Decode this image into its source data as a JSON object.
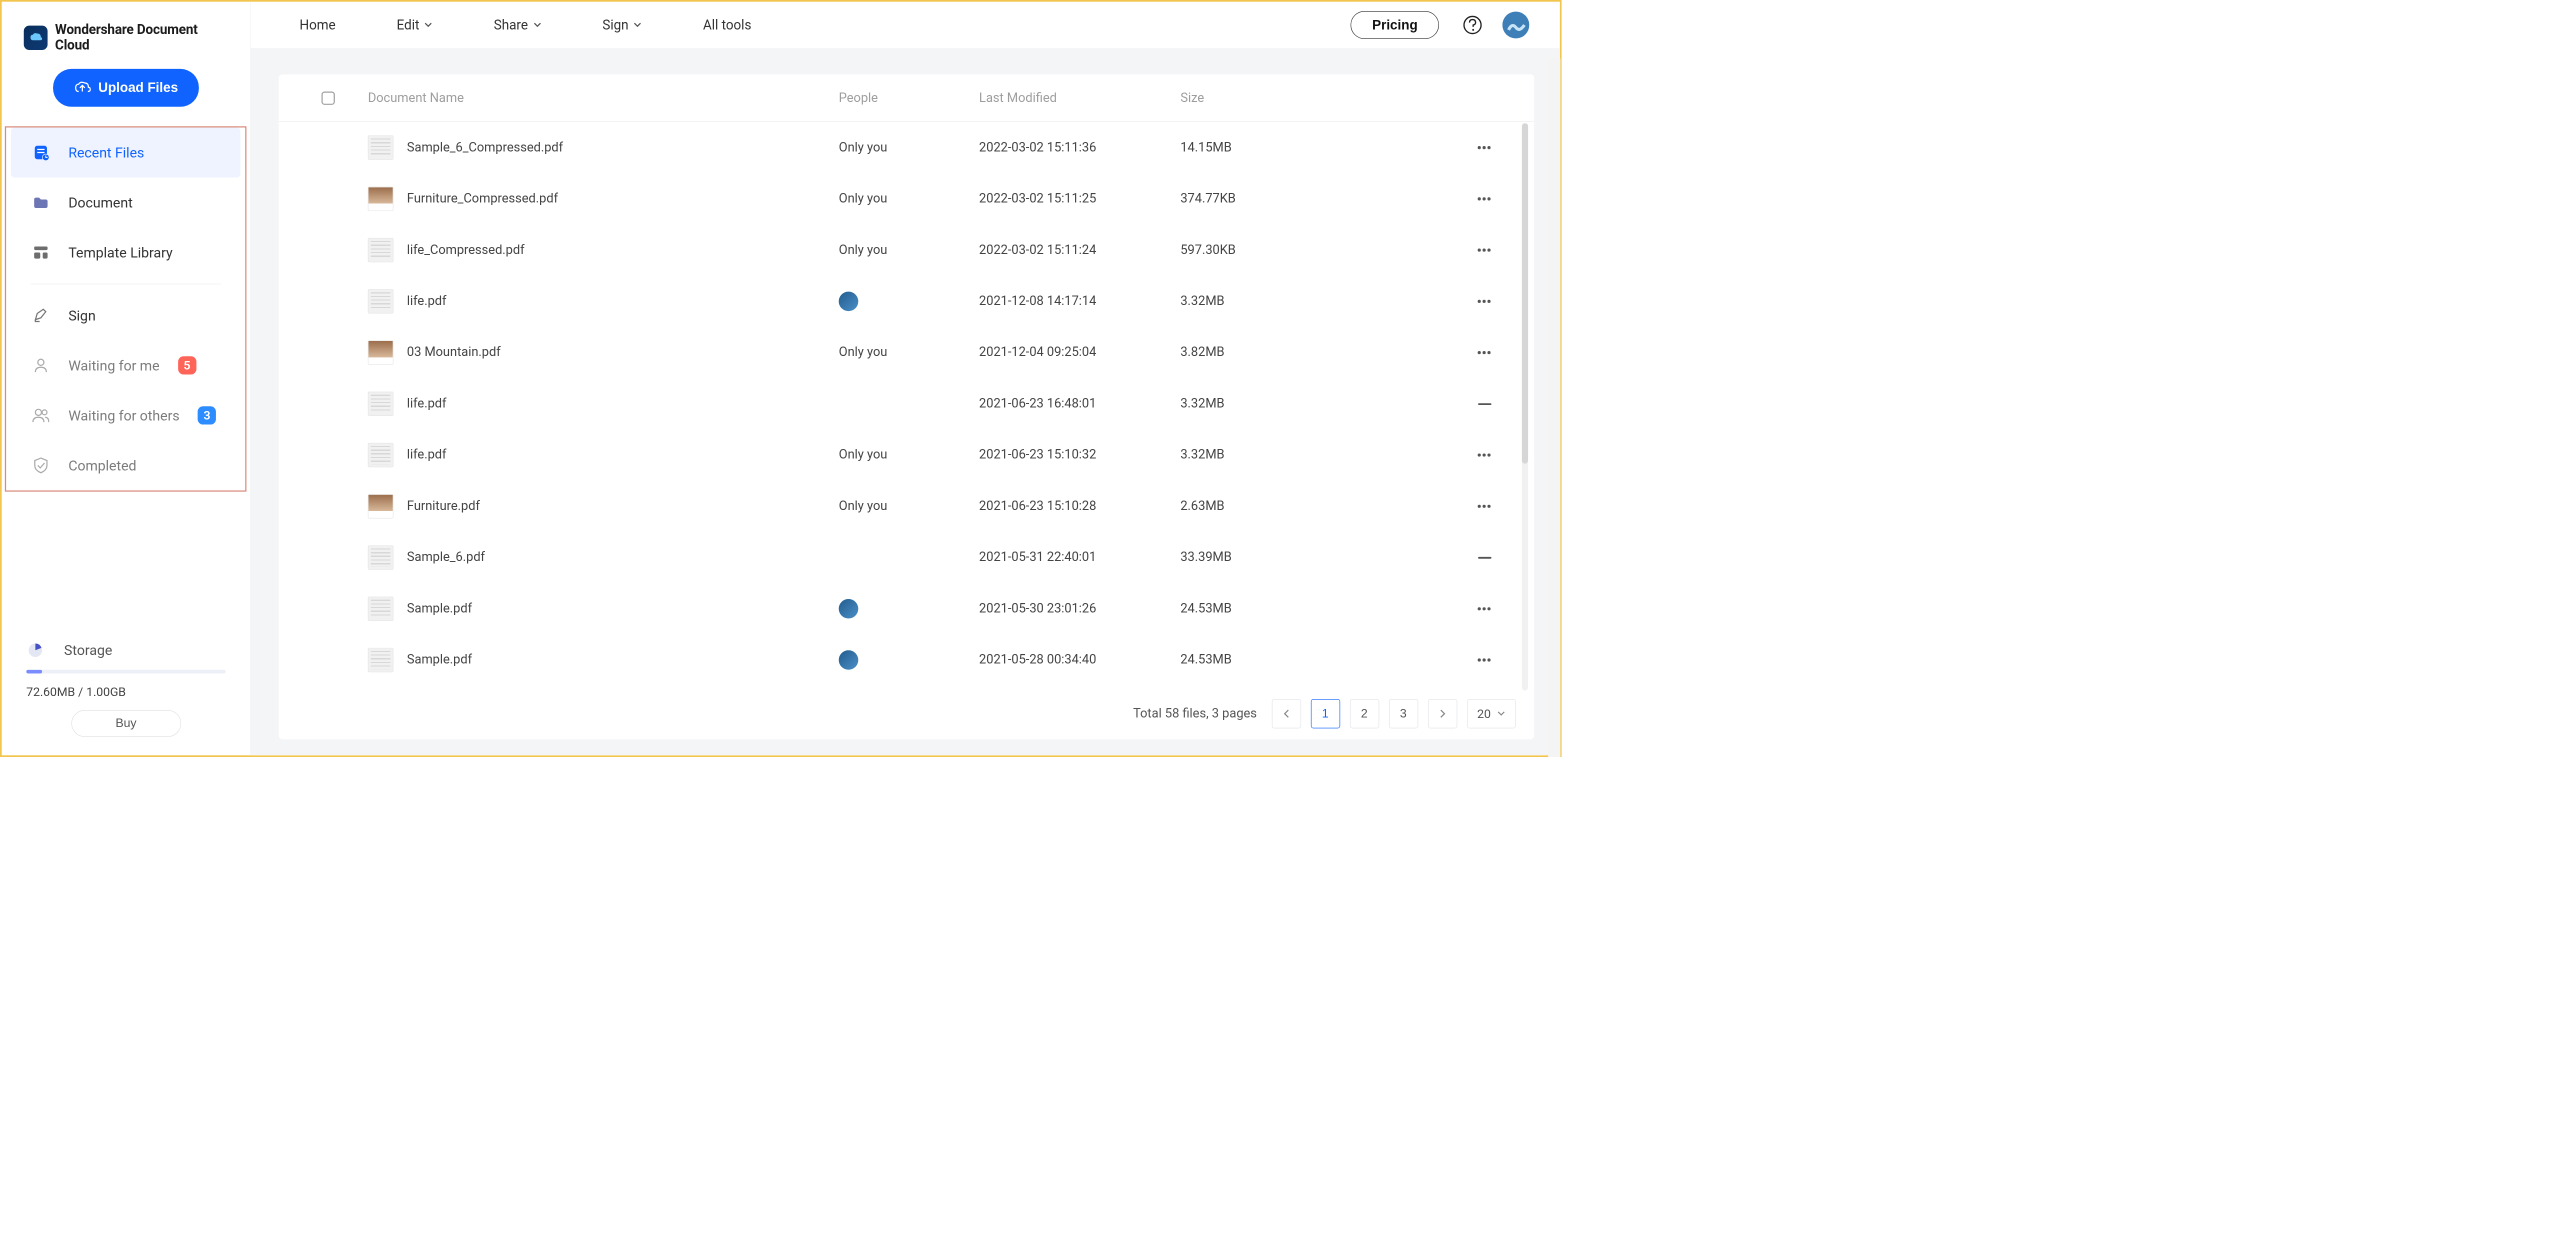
{
  "brand": "Wondershare Document Cloud",
  "upload_label": "Upload Files",
  "nav": {
    "recent": "Recent Files",
    "document": "Document",
    "template_library": "Template Library",
    "sign": "Sign",
    "waiting_for_me": "Waiting for me",
    "waiting_for_me_count": "5",
    "waiting_for_others": "Waiting for others",
    "waiting_for_others_count": "3",
    "completed": "Completed"
  },
  "storage": {
    "label": "Storage",
    "usage": "72.60MB / 1.00GB",
    "buy_label": "Buy"
  },
  "topnav": {
    "home": "Home",
    "edit": "Edit",
    "share": "Share",
    "sign": "Sign",
    "all_tools": "All tools",
    "pricing": "Pricing"
  },
  "table": {
    "columns": {
      "name": "Document Name",
      "people": "People",
      "modified": "Last Modified",
      "size": "Size"
    },
    "rows": [
      {
        "name": "Sample_6_Compressed.pdf",
        "people_type": "text",
        "people": "Only you",
        "modified": "2022-03-02 15:11:36",
        "size": "14.15MB",
        "action": "dots",
        "thumb": "doc"
      },
      {
        "name": "Furniture_Compressed.pdf",
        "people_type": "text",
        "people": "Only you",
        "modified": "2022-03-02 15:11:25",
        "size": "374.77KB",
        "action": "dots",
        "thumb": "img"
      },
      {
        "name": "life_Compressed.pdf",
        "people_type": "text",
        "people": "Only you",
        "modified": "2022-03-02 15:11:24",
        "size": "597.30KB",
        "action": "dots",
        "thumb": "doc"
      },
      {
        "name": "life.pdf",
        "people_type": "avatar",
        "people": "",
        "modified": "2021-12-08 14:17:14",
        "size": "3.32MB",
        "action": "dots",
        "thumb": "doc"
      },
      {
        "name": "03 Mountain.pdf",
        "people_type": "text",
        "people": "Only you",
        "modified": "2021-12-04 09:25:04",
        "size": "3.82MB",
        "action": "dots",
        "thumb": "img"
      },
      {
        "name": "life.pdf",
        "people_type": "none",
        "people": "",
        "modified": "2021-06-23 16:48:01",
        "size": "3.32MB",
        "action": "minus",
        "thumb": "doc"
      },
      {
        "name": "life.pdf",
        "people_type": "text",
        "people": "Only you",
        "modified": "2021-06-23 15:10:32",
        "size": "3.32MB",
        "action": "dots",
        "thumb": "doc"
      },
      {
        "name": "Furniture.pdf",
        "people_type": "text",
        "people": "Only you",
        "modified": "2021-06-23 15:10:28",
        "size": "2.63MB",
        "action": "dots",
        "thumb": "img"
      },
      {
        "name": "Sample_6.pdf",
        "people_type": "none",
        "people": "",
        "modified": "2021-05-31 22:40:01",
        "size": "33.39MB",
        "action": "minus",
        "thumb": "doc"
      },
      {
        "name": "Sample.pdf",
        "people_type": "avatar",
        "people": "",
        "modified": "2021-05-30 23:01:26",
        "size": "24.53MB",
        "action": "dots",
        "thumb": "doc"
      },
      {
        "name": "Sample.pdf",
        "people_type": "avatar",
        "people": "",
        "modified": "2021-05-28 00:34:40",
        "size": "24.53MB",
        "action": "dots",
        "thumb": "doc"
      }
    ]
  },
  "pagination": {
    "summary": "Total 58 files, 3 pages",
    "pages": [
      "1",
      "2",
      "3"
    ],
    "page_size": "20"
  }
}
